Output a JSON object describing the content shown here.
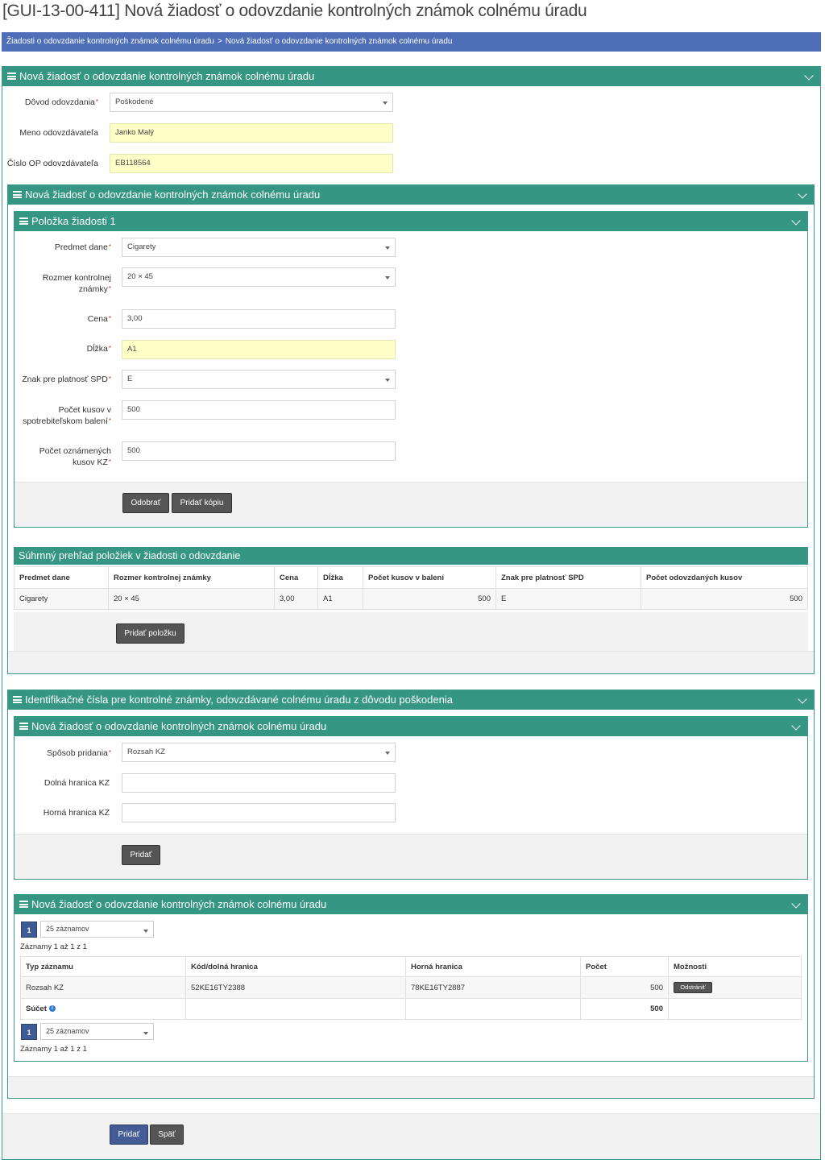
{
  "page": {
    "title": "[GUI-13-00-411] Nová žiadosť o odovzdanie kontrolných známok colnému úradu"
  },
  "breadcrumb": {
    "items": [
      "Žiadosti o odovzdanie kontrolných známok colnému úradu",
      "Nová žiadosť o odovzdanie kontrolných známok colnému úradu"
    ],
    "separator": ">"
  },
  "main_panel": {
    "title": "Nová žiadosť o odovzdanie kontrolných známok colnému úradu",
    "fields": {
      "reason_label": "Dôvod odovzdania",
      "reason_value": "Poškodené",
      "name_label": "Meno odovzdávateľa",
      "name_value": "Janko Malý",
      "id_label": "Číslo OP odovzdávateľa",
      "id_value": "EB118564"
    }
  },
  "items_panel": {
    "title": "Nová žiadosť o odovzdanie kontrolných známok colnému úradu",
    "item": {
      "title": "Položka žiadosti 1",
      "subject_label": "Predmet dane",
      "subject_value": "Cigarety",
      "size_label_1": "Rozmer kontrolnej",
      "size_label_2": "známky",
      "size_value": "20 × 45",
      "price_label": "Cena",
      "price_value": "3,00",
      "length_label": "Dĺžka",
      "length_value": "A1",
      "spd_label": "Znak pre platnosť SPD",
      "spd_value": "E",
      "pieces_label_1": "Počet kusov v",
      "pieces_label_2": "spotrebiteľskom balení",
      "pieces_value": "500",
      "announced_label_1": "Počet oznámených",
      "announced_label_2": "kusov KZ",
      "announced_value": "500",
      "remove_button": "Odobrať",
      "copy_button": "Pridať kópiu"
    },
    "summary": {
      "title": "Súhrnný prehľad položiek v žiadosti o odovzdanie",
      "columns": [
        "Predmet dane",
        "Rozmer kontrolnej známky",
        "Cena",
        "Dĺžka",
        "Počet kusov v balení",
        "Znak pre platnosť SPD",
        "Počet odovzdaných kusov"
      ],
      "rows": [
        [
          "Cigarety",
          "20 × 45",
          "3,00",
          "A1",
          "500",
          "E",
          "500"
        ]
      ],
      "add_item_button": "Pridať položku"
    }
  },
  "ids_panel": {
    "title": "Identifikačné čísla pre kontrolné známky, odovzdávané colnému úradu z dôvodu poškodenia",
    "form": {
      "title": "Nová žiadosť o odovzdanie kontrolných známok colnému úradu",
      "method_label": "Spôsob pridania",
      "method_value": "Rozsah KZ",
      "lower_label": "Dolná hranica KZ",
      "lower_value": "",
      "upper_label": "Horná hranica KZ",
      "upper_value": "",
      "add_button": "Pridať"
    },
    "list": {
      "title": "Nová žiadosť o odovzdanie kontrolných známok colnému úradu",
      "page_number": "1",
      "page_size": "25 záznamov",
      "records_info": "Záznamy 1 až 1 z 1",
      "columns": [
        "Typ záznamu",
        "Kód/dolná hranica",
        "Horná hranica",
        "Počet",
        "Možnosti"
      ],
      "rows": [
        {
          "type": "Rozsah KZ",
          "lower": "52KE16TY2388",
          "upper": "78KE16TY2887",
          "count": "500",
          "action": "Odstrániť"
        }
      ],
      "sum_label": "Súčet",
      "sum_value": "500"
    }
  },
  "footer": {
    "add_button": "Pridať",
    "back_button": "Späť"
  },
  "colors": {
    "panel_header": "#349683",
    "breadcrumb_bg": "#4e6fb7",
    "highlight_field": "#ffffc8",
    "primary_button": "#445c94",
    "secondary_button": "#555555"
  }
}
